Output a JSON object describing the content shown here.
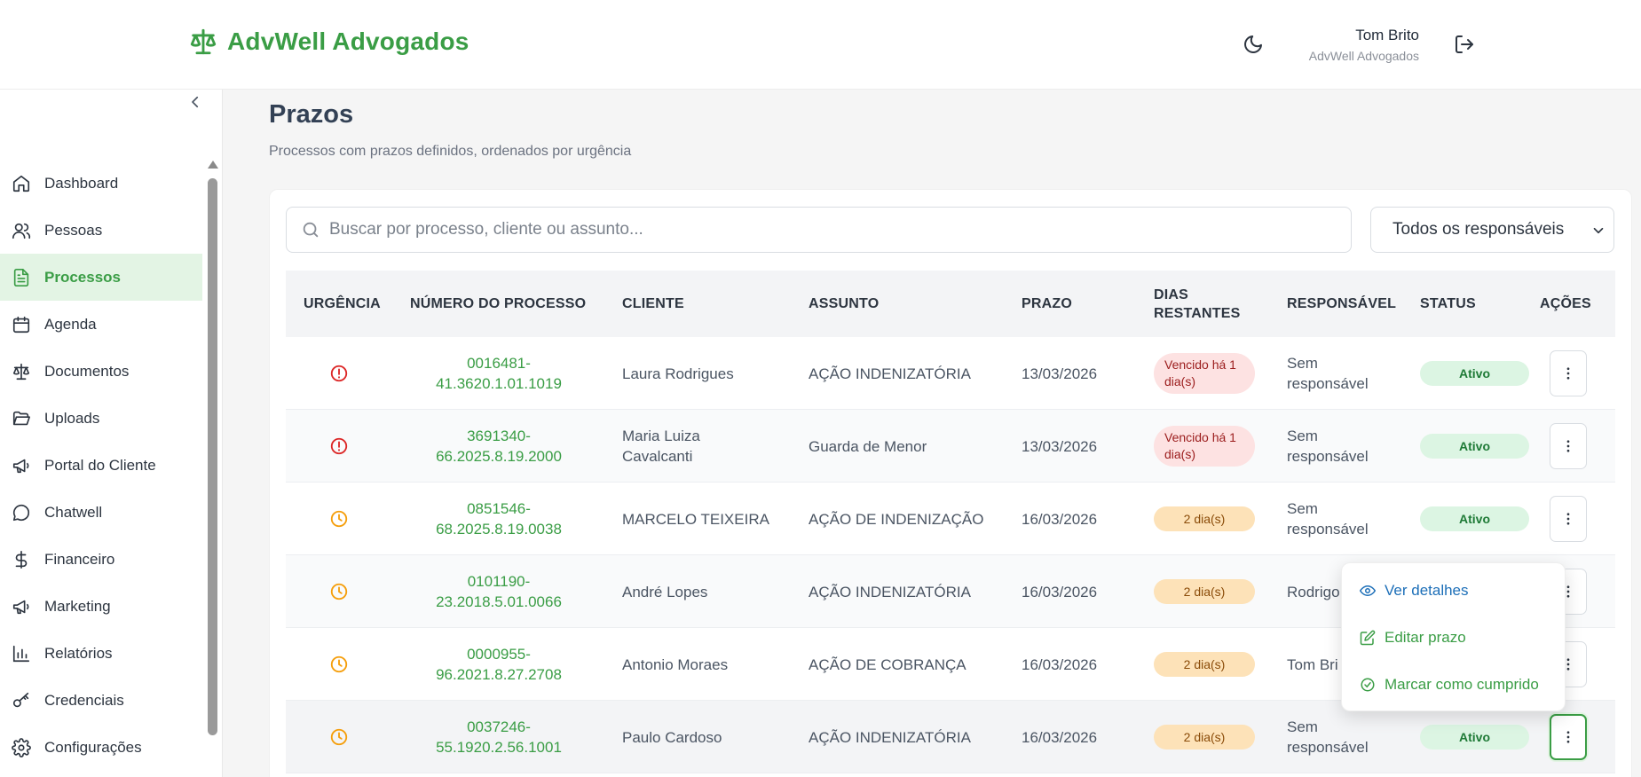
{
  "header": {
    "brand": "AdvWell Advogados",
    "user_name": "Tom Brito",
    "user_org": "AdvWell Advogados"
  },
  "sidebar": {
    "items": [
      {
        "label": "Dashboard",
        "icon": "home-icon"
      },
      {
        "label": "Pessoas",
        "icon": "users-icon"
      },
      {
        "label": "Processos",
        "icon": "file-text-icon",
        "active": true
      },
      {
        "label": "Agenda",
        "icon": "calendar-icon"
      },
      {
        "label": "Documentos",
        "icon": "scale-icon"
      },
      {
        "label": "Uploads",
        "icon": "folder-open-icon"
      },
      {
        "label": "Portal do Cliente",
        "icon": "megaphone-icon"
      },
      {
        "label": "Chatwell",
        "icon": "chat-bubble-icon"
      },
      {
        "label": "Financeiro",
        "icon": "dollar-icon"
      },
      {
        "label": "Marketing",
        "icon": "megaphone-icon"
      },
      {
        "label": "Relatórios",
        "icon": "bar-chart-icon"
      },
      {
        "label": "Credenciais",
        "icon": "key-icon"
      },
      {
        "label": "Configurações",
        "icon": "gear-icon"
      }
    ]
  },
  "main": {
    "title": "Prazos",
    "subtitle": "Processos com prazos definidos, ordenados por urgência",
    "search_placeholder": "Buscar por processo, cliente ou assunto...",
    "filter_value": "Todos os responsáveis"
  },
  "table": {
    "headers": {
      "urgencia": "URGÊNCIA",
      "numero": "NÚMERO DO PROCESSO",
      "cliente": "CLIENTE",
      "assunto": "ASSUNTO",
      "prazo": "PRAZO",
      "dias_1": "DIAS",
      "dias_2": "RESTANTES",
      "responsavel": "RESPONSÁVEL",
      "status": "STATUS",
      "acoes": "AÇÕES"
    },
    "rows": [
      {
        "urgency": "overdue",
        "num_1": "0016481-",
        "num_2": "41.3620.1.01.1019",
        "cliente_1": "Laura Rodrigues",
        "cliente_2": "",
        "assunto": "AÇÃO INDENIZATÓRIA",
        "prazo": "13/03/2026",
        "dias_1": "Vencido há 1",
        "dias_2": "dia(s)",
        "resp_1": "Sem",
        "resp_2": "responsável",
        "status": "Ativo"
      },
      {
        "urgency": "overdue",
        "num_1": "3691340-",
        "num_2": "66.2025.8.19.2000",
        "cliente_1": "Maria Luiza",
        "cliente_2": "Cavalcanti",
        "assunto": "Guarda de Menor",
        "prazo": "13/03/2026",
        "dias_1": "Vencido há 1",
        "dias_2": "dia(s)",
        "resp_1": "Sem",
        "resp_2": "responsável",
        "status": "Ativo"
      },
      {
        "urgency": "soon",
        "num_1": "0851546-",
        "num_2": "68.2025.8.19.0038",
        "cliente_1": "MARCELO TEIXEIRA",
        "cliente_2": "",
        "assunto": "AÇÃO DE INDENIZAÇÃO",
        "prazo": "16/03/2026",
        "dias_1": "2 dia(s)",
        "dias_2": "",
        "resp_1": "Sem",
        "resp_2": "responsável",
        "status": "Ativo"
      },
      {
        "urgency": "soon",
        "num_1": "0101190-",
        "num_2": "23.2018.5.01.0066",
        "cliente_1": "André Lopes",
        "cliente_2": "",
        "assunto": "AÇÃO INDENIZATÓRIA",
        "prazo": "16/03/2026",
        "dias_1": "2 dia(s)",
        "dias_2": "",
        "resp_1": "Rodrigo",
        "resp_2": "",
        "status": ""
      },
      {
        "urgency": "soon",
        "num_1": "0000955-",
        "num_2": "96.2021.8.27.2708",
        "cliente_1": "Antonio Moraes",
        "cliente_2": "",
        "assunto": "AÇÃO DE COBRANÇA",
        "prazo": "16/03/2026",
        "dias_1": "2 dia(s)",
        "dias_2": "",
        "resp_1": "Tom Bri",
        "resp_2": "",
        "status": ""
      },
      {
        "urgency": "soon",
        "num_1": "0037246-",
        "num_2": "55.1920.2.56.1001",
        "cliente_1": "Paulo Cardoso",
        "cliente_2": "",
        "assunto": "AÇÃO INDENIZATÓRIA",
        "prazo": "16/03/2026",
        "dias_1": "2 dia(s)",
        "dias_2": "",
        "resp_1": "Sem",
        "resp_2": "responsável",
        "status": "Ativo"
      }
    ]
  },
  "menu": {
    "view": "Ver detalhes",
    "edit": "Editar prazo",
    "done": "Marcar como cumprido"
  },
  "colors": {
    "brand": "#3a9d45",
    "overdue": "#dc2626",
    "soon": "#f59e0b",
    "link_blue": "#1d6fb8"
  }
}
